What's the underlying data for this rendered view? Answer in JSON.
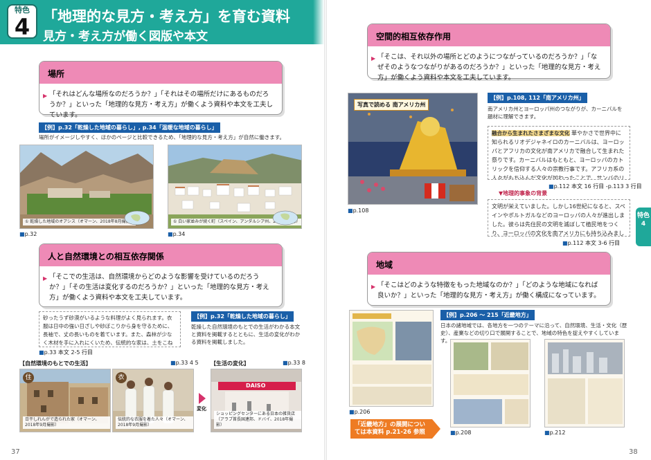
{
  "header": {
    "feature_label": "特色",
    "feature_number": "4",
    "title": "「地理的な見方・考え方」を育む資料",
    "subtitle": "見方・考え方が働く図版や本文"
  },
  "left": {
    "place": {
      "heading": "場所",
      "text": "「それはどんな場所なのだろうか？」「それはその場所だけにあるものだろうか？」といった「地理的な見方・考え方」が働くよう資料や本文を工夫しています。",
      "example_tag": "【例】p.32「乾燥した地域の暮らし」, p.34「温暖な地域の暮らし」",
      "example_text": "場所がイメージしやすく、ほかのページと比較できるため、「地理的な見方・考え方」が自然に働きます。",
      "photo1_caption": "① 乾燥した地域のオアシス（オマーン、2018年8月撮影）",
      "photo1_ref": "p.32",
      "photo2_caption": "① 白い家並みが続く町（スペイン、アンダルシア州、2016年撮影）",
      "photo2_ref": "p.34"
    },
    "interdep": {
      "heading": "人と自然環境との相互依存関係",
      "text": "「そこでの生活は、自然環境からどのような影響を受けているのだろうか？」「その生活は変化するのだろうか？」といった「地理的な見方・考え方」が働くよう資料や本文を工夫しています。",
      "note_text": "砂ったうず砂漠がいるような料理がよく見られます。衣服は日中の強い日ざしや砂ぼこりから身を守るために、長袖で、丈の長いものを着ています。また、森林が少なく木材を手に入れにくいため、伝統的な家は、土をこねて作った日干しれんがを利用しています。",
      "note_ref": "p.33 本文 2-5 行目",
      "example_tag": "【例】p.32「乾燥した地域の暮らし」",
      "example_text": "乾燥した自然環境のもとでの生活がわかる本文と資料を掲載するとともに、生活の変化がわかる資料を掲載しました。",
      "label_nature": "【自然環境のもとでの生活】",
      "label_nature_ref": "p.33 4 5",
      "label_change": "【生活の変化】",
      "label_change_ref": "p.33 8",
      "label_house": "住",
      "label_clothes": "衣",
      "change_word": "変化",
      "photo_house_caption": "日干しれんがで造られた家（オマーン、2018年9月撮影）",
      "photo_clothes_caption": "伝統的な衣服を着た人々（オマーン、2018年9月撮影）",
      "photo_mall_caption": "ショッピングセンターにある日本の雑貨店（アラブ首長国連邦、ドバイ、2018年撮影）",
      "mall_sign": "DAISO"
    },
    "page_number": "37"
  },
  "right": {
    "spatial": {
      "heading": "空間的相互依存作用",
      "text": "「そこは、それ以外の場所とどのようにつながっているのだろうか？」「なぜそのようなつながりがあるのだろうか？」といった「地理的な見方・考え方」が働くよう資料や本文を工夫しています。",
      "example_tag": "【例】p.108, 112「南アメリカ州」",
      "example_text": "南アメリカ州とヨーロッパ州のつながりが、カーニバルを題材に理解できます。",
      "photo_title": "写真で読める 南アメリカ州",
      "photo_ref": "p.108",
      "note1_label": "融合から生まれたさまざまな文化",
      "note1_text": "華やかさで世界中に知られるリオデジャネイロのカーニバルは、ヨーロッパとアフリカの文化が南アメリカで融合して生まれた祭りです。カーニバルはもともと、ヨーロッパのカトリックを信仰する人々の宗教行事です。アフリカ系の人々がもち込んだ文化が加わったことで、サンバのリズムで踊るにぎやかな祭りに変化しました。アルゼンチンの舞踊音",
      "note1_ref": "p.112 本文 16 行目 -p.113 3 行目",
      "note2_label": "▼地理的事象の背景",
      "note2_text": "文明が栄えていました。しかし16世紀になると、スペインやポルトガルなどのヨーロッパの人々が進出しました。彼らは先住民の文明を滅ぼして植民地をつくり、ヨーロッパの文化を南アメリカにも持ち込みました。そのため、現在でも多くの国々でスペイン語やポル",
      "note2_ref": "p.112 本文 3-6 行目"
    },
    "region": {
      "heading": "地域",
      "text": "「そこはどのような特徴をもった地域なのか？」「どのような地域になれば良いか？」といった「地理的な見方・考え方」が働く構成になっています。",
      "example_tag": "【例】p.206 〜 215「近畿地方」",
      "example_text": "日本の諸地域では、各地方を一つのテーマに沿って、自然環境、生活・文化（歴史）、産業などの切り口で展開することで、地域の特色を捉えやすくしています。",
      "thumb1_ref": "p.206",
      "thumb2_ref": "p.208",
      "thumb3_ref": "p.212",
      "arrow_text": "「近畿地方」の展開については本資料 p.21-26 参照"
    },
    "side_tab": "特色 4",
    "page_number": "38"
  },
  "colors": {
    "teal": "#1fa89a",
    "pink": "#ee8ab6",
    "blue": "#1a5fa8",
    "orange": "#ee7b23"
  }
}
